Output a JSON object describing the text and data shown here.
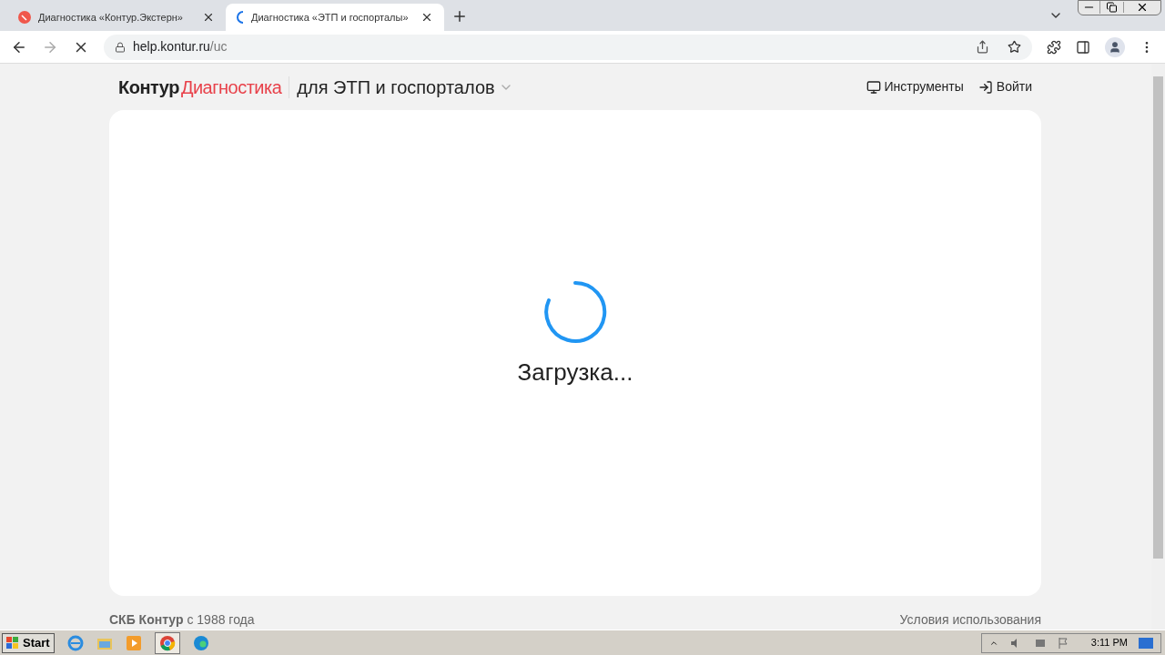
{
  "tabs": [
    {
      "title": "Диагностика «Контур.Экстерн»",
      "selected": false,
      "loading": false
    },
    {
      "title": "Диагностика «ЭТП и госпорталы»",
      "selected": true,
      "loading": true
    }
  ],
  "address_bar": {
    "host": "help.kontur.ru",
    "path": "/uc"
  },
  "header": {
    "brand": "Контур",
    "product": "Диагностика",
    "section": "для ЭТП и госпорталов",
    "links": [
      {
        "kind": "tools",
        "label": "Инструменты"
      },
      {
        "kind": "login",
        "label": "Войти"
      }
    ]
  },
  "content": {
    "loading_text": "Загрузка..."
  },
  "footer": {
    "copyright": "**СКБ Контур** с 1988 года",
    "terms": "Условия использования"
  },
  "taskbar": {
    "start": "Start",
    "clock": "3:11 PM"
  }
}
